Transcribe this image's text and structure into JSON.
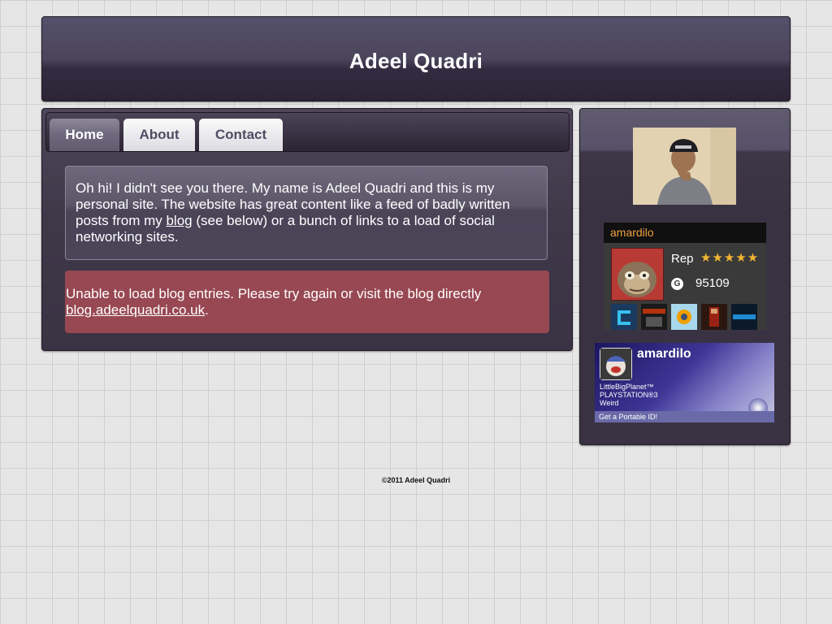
{
  "header": {
    "title": "Adeel Quadri"
  },
  "nav": {
    "tabs": [
      {
        "label": "Home"
      },
      {
        "label": "About"
      },
      {
        "label": "Contact"
      }
    ]
  },
  "intro": {
    "text_before_link": "Oh hi! I didn't see you there. My name is Adeel Quadri and this is my personal site. The website has great content like a feed of badly written posts from my ",
    "link_text": "blog",
    "text_after_link": " (see below) or a bunch of links to a load of social networking sites."
  },
  "error": {
    "message": "Unable to load blog entries. Please try again or visit the blog directly ",
    "link_text": "blog.adeelquadri.co.uk",
    "trailing": "."
  },
  "xbox_card": {
    "gamertag": "amardilo",
    "rep_label": "Rep",
    "rep_stars": "★★★★★",
    "gamerscore_icon": "G",
    "gamerscore": "95109",
    "game_tiles": [
      {
        "color": "#1b3a5e",
        "accent": "#36c2ee"
      },
      {
        "color": "#1a1a1a",
        "accent": "#b4330c"
      },
      {
        "color": "#a7d8ec",
        "accent": "#f0a000"
      },
      {
        "color": "#2b1710",
        "accent": "#9a2214"
      },
      {
        "color": "#0b1a2a",
        "accent": "#1e8ad2"
      }
    ]
  },
  "psn_card": {
    "name": "amardilo",
    "game": "LittleBigPlanet™",
    "platform": "PLAYSTATION®3",
    "status": "Weird",
    "footer_link": "Get a Portable ID!"
  },
  "footer": {
    "copyright": "©2011 Adeel Quadri"
  }
}
